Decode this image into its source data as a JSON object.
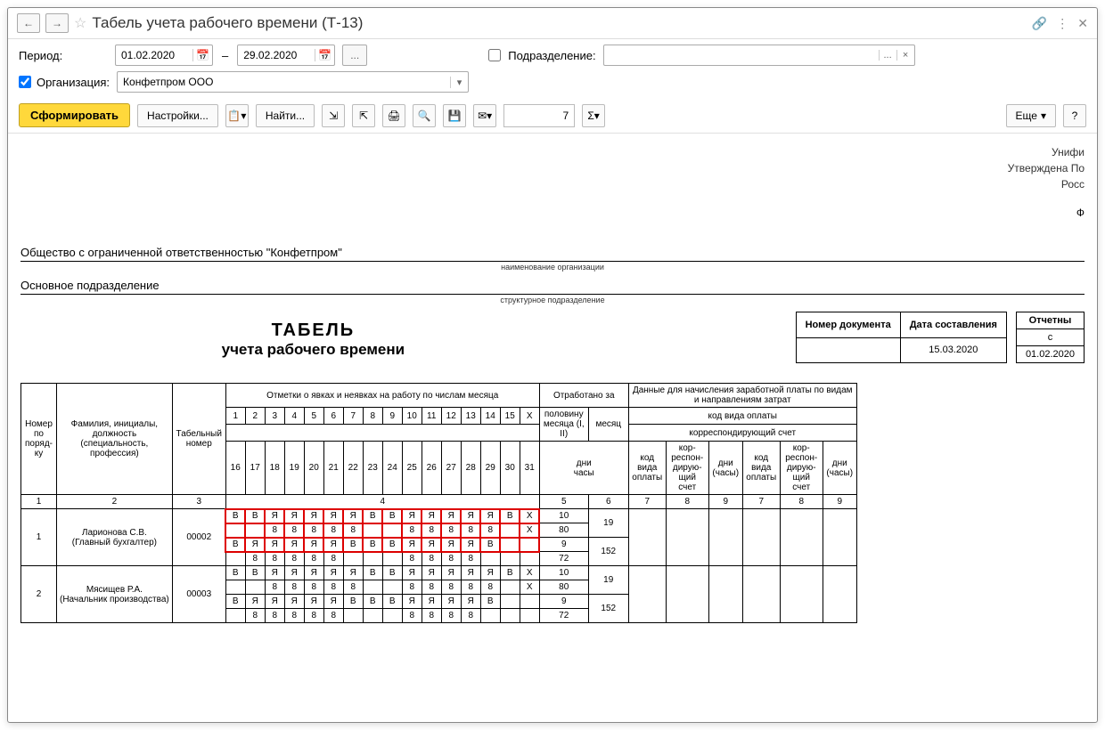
{
  "window": {
    "title": "Табель учета рабочего времени (Т-13)"
  },
  "filters": {
    "period_label": "Период:",
    "date_from": "01.02.2020",
    "date_to": "29.02.2020",
    "subdiv_label": "Подразделение:",
    "subdiv_value": "",
    "org_label": "Организация:",
    "org_value": "Конфетпром ООО"
  },
  "toolbar": {
    "generate": "Сформировать",
    "settings": "Настройки...",
    "find": "Найти...",
    "more": "Еще",
    "page_input": "7"
  },
  "report": {
    "header_lines": [
      "Унифи",
      "Утверждена По",
      "Росс"
    ],
    "company_full": "Общество с ограниченной ответственностью \"Конфетпром\"",
    "org_caption": "наименование организации",
    "dept_name": "Основное подразделение",
    "dept_caption": "структурное подразделение",
    "doc_title1": "ТАБЕЛЬ",
    "doc_title2": "учета  рабочего времени",
    "meta": {
      "doc_num_h": "Номер документа",
      "doc_num": "",
      "date_h": "Дата составления",
      "date": "15.03.2020",
      "rep_h": "Отчетны",
      "rep_sub": "с",
      "rep_from": "01.02.2020"
    }
  },
  "columns": {
    "c1": "Номер по поряд-ку",
    "c2": "Фамилия, инициалы, должность (специальность, профессия)",
    "c3": "Табельный номер",
    "c4": "Отметки о явках и неявках на работу по числам месяца",
    "worked": "Отработано за",
    "half": "половину месяца (I, II)",
    "month": "месяц",
    "days": "дни",
    "hours": "часы",
    "pay_hdr": "Данные для начисления заработной платы по видам и направлениям затрат",
    "pay_code": "код вида оплаты",
    "corr": "корреспондирующий счет",
    "k_code": "код вида оплаты",
    "k_corr": "кор-респон-дирую-щий счет",
    "k_dh": "дни (часы)"
  },
  "col_nums": [
    "1",
    "2",
    "3",
    "4",
    "5",
    "6",
    "7",
    "8",
    "9",
    "7",
    "8",
    "9"
  ],
  "employees": [
    {
      "num": "1",
      "name": "Ларионова С.В.",
      "role": "(Главный бухгалтер)",
      "tab": "00002",
      "r1": [
        "В",
        "В",
        "Я",
        "Я",
        "Я",
        "Я",
        "Я",
        "В",
        "В",
        "Я",
        "Я",
        "Я",
        "Я",
        "Я",
        "В",
        "Х"
      ],
      "r2": [
        "",
        "",
        "8",
        "8",
        "8",
        "8",
        "8",
        "",
        "",
        "8",
        "8",
        "8",
        "8",
        "8",
        "",
        "Х"
      ],
      "r3": [
        "В",
        "Я",
        "Я",
        "Я",
        "Я",
        "Я",
        "В",
        "В",
        "В",
        "Я",
        "Я",
        "Я",
        "Я",
        "В",
        "",
        ""
      ],
      "r4": [
        "",
        "8",
        "8",
        "8",
        "8",
        "8",
        "",
        "",
        "",
        "8",
        "8",
        "8",
        "8",
        "",
        "",
        ""
      ],
      "half_days": "10",
      "half_hours": "80",
      "half2_days": "9",
      "half2_hours": "72",
      "month_days": "19",
      "month_hours": "152"
    },
    {
      "num": "2",
      "name": "Мясищев Р.А.",
      "role": "(Начальник производства)",
      "tab": "00003",
      "r1": [
        "В",
        "В",
        "Я",
        "Я",
        "Я",
        "Я",
        "Я",
        "В",
        "В",
        "Я",
        "Я",
        "Я",
        "Я",
        "Я",
        "В",
        "Х"
      ],
      "r2": [
        "",
        "",
        "8",
        "8",
        "8",
        "8",
        "8",
        "",
        "",
        "8",
        "8",
        "8",
        "8",
        "8",
        "",
        "Х"
      ],
      "r3": [
        "В",
        "Я",
        "Я",
        "Я",
        "Я",
        "Я",
        "В",
        "В",
        "В",
        "Я",
        "Я",
        "Я",
        "Я",
        "В",
        "",
        ""
      ],
      "r4": [
        "",
        "8",
        "8",
        "8",
        "8",
        "8",
        "",
        "",
        "",
        "8",
        "8",
        "8",
        "8",
        "",
        "",
        ""
      ],
      "half_days": "10",
      "half_hours": "80",
      "half2_days": "9",
      "half2_hours": "72",
      "month_days": "19",
      "month_hours": "152"
    }
  ]
}
